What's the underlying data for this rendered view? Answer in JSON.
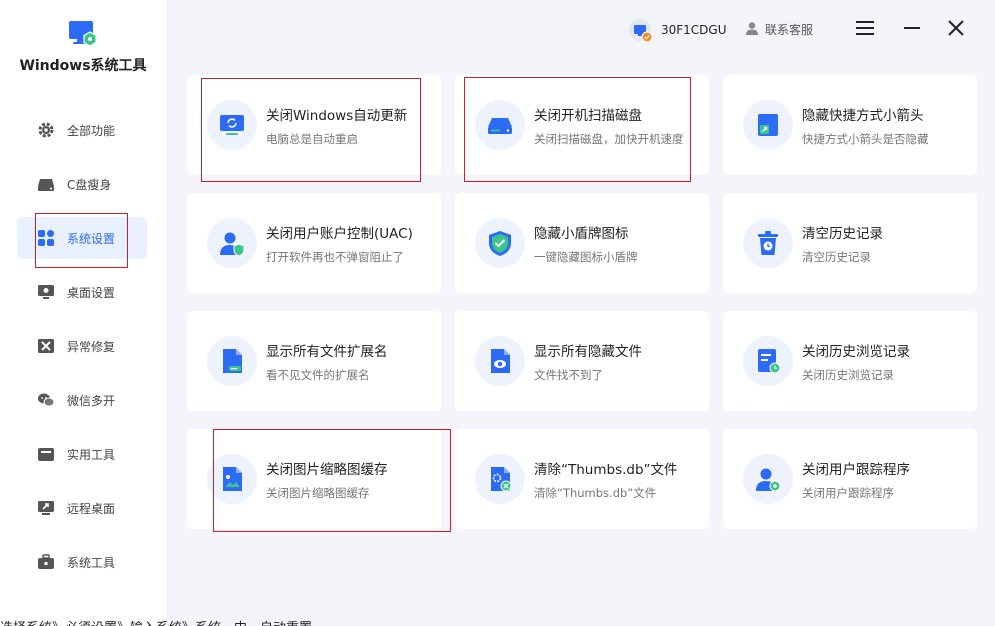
{
  "app": {
    "title": "Windows系统工具",
    "accent": "#2c6bf5"
  },
  "sidebar": {
    "items": [
      {
        "label": "全部功能",
        "icon": "gear-icon"
      },
      {
        "label": "C盘瘦身",
        "icon": "drive-icon"
      },
      {
        "label": "系统设置",
        "icon": "grid-icon",
        "active": true
      },
      {
        "label": "桌面设置",
        "icon": "monitor-icon"
      },
      {
        "label": "异常修复",
        "icon": "tools-icon"
      },
      {
        "label": "微信多开",
        "icon": "wechat-icon"
      },
      {
        "label": "实用工具",
        "icon": "toolbox-icon"
      },
      {
        "label": "远程桌面",
        "icon": "remote-icon"
      },
      {
        "label": "系统工具",
        "icon": "briefcase-icon"
      }
    ]
  },
  "topbar": {
    "user_id": "30F1CDGU",
    "support_label": "联系客服"
  },
  "cards": [
    {
      "title": "关闭Windows自动更新",
      "sub": "电脑总是自动重启",
      "icon": "update-icon"
    },
    {
      "title": "关闭开机扫描磁盘",
      "sub": "关闭扫描磁盘，加快开机速度",
      "icon": "disk-icon"
    },
    {
      "title": "隐藏快捷方式小箭头",
      "sub": "快捷方式小箭头是否隐藏",
      "icon": "shortcut-icon"
    },
    {
      "title": "关闭用户账户控制(UAC)",
      "sub": "打开软件再也不弹窗阻止了",
      "icon": "uac-icon"
    },
    {
      "title": "隐藏小盾牌图标",
      "sub": "一键隐藏图标小盾牌",
      "icon": "shield-icon"
    },
    {
      "title": "清空历史记录",
      "sub": "清空历史记录",
      "icon": "trash-icon"
    },
    {
      "title": "显示所有文件扩展名",
      "sub": "看不见文件的扩展名",
      "icon": "file-ext-icon"
    },
    {
      "title": "显示所有隐藏文件",
      "sub": "文件找不到了",
      "icon": "hidden-file-icon"
    },
    {
      "title": "关闭历史浏览记录",
      "sub": "关闭历史浏览记录",
      "icon": "history-icon"
    },
    {
      "title": "关闭图片缩略图缓存",
      "sub": "关闭图片缩略图缓存",
      "icon": "image-cache-icon"
    },
    {
      "title": "清除“Thumbs.db”文件",
      "sub": "清除“Thumbs.db”文件",
      "icon": "thumbs-db-icon"
    },
    {
      "title": "关闭用户跟踪程序",
      "sub": "关闭用户跟踪程序",
      "icon": "user-track-icon"
    }
  ],
  "bottom_text": "选择系统》必须设置》输入系统》系统，中，自动重置"
}
